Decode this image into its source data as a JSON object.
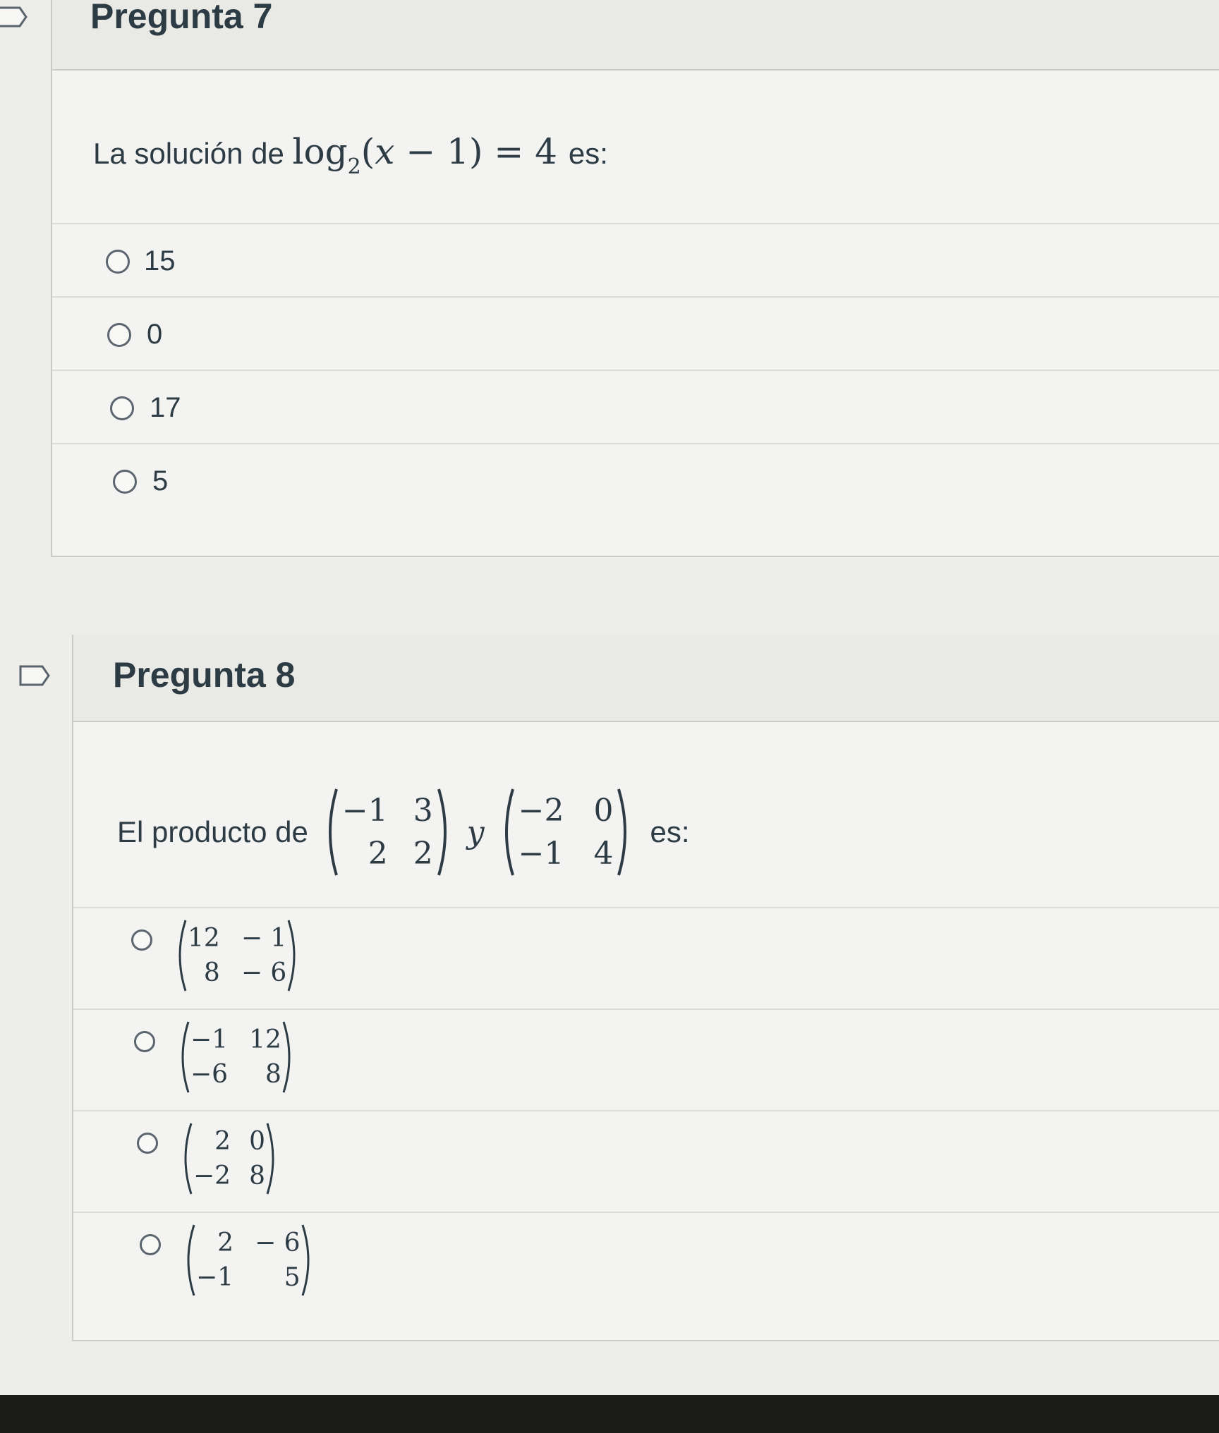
{
  "q7": {
    "title": "Pregunta 7",
    "text_prefix": "La solución de",
    "math_log": "log",
    "math_base": "2",
    "math_open": "(",
    "math_var": "x",
    "math_rest": " − 1) = 4",
    "text_suffix": "es:",
    "answers": [
      "15",
      "0",
      "17",
      "5"
    ]
  },
  "q8": {
    "title": "Pregunta 8",
    "text_prefix": "El producto de",
    "conjunction": "y",
    "text_suffix": "es:",
    "matrix_a": [
      "−1",
      "3",
      "2",
      "2"
    ],
    "matrix_b": [
      "−2",
      "0",
      "−1",
      "4"
    ],
    "answers": [
      [
        "12",
        "− 1",
        "8",
        "− 6"
      ],
      [
        "−1",
        "12",
        "−6",
        "8"
      ],
      [
        "2",
        "0",
        "−2",
        "8"
      ],
      [
        "2",
        "− 6",
        "−1",
        "5"
      ]
    ]
  },
  "icons": {
    "flag": "flag-outline-icon",
    "radio": "radio-button-icon"
  }
}
